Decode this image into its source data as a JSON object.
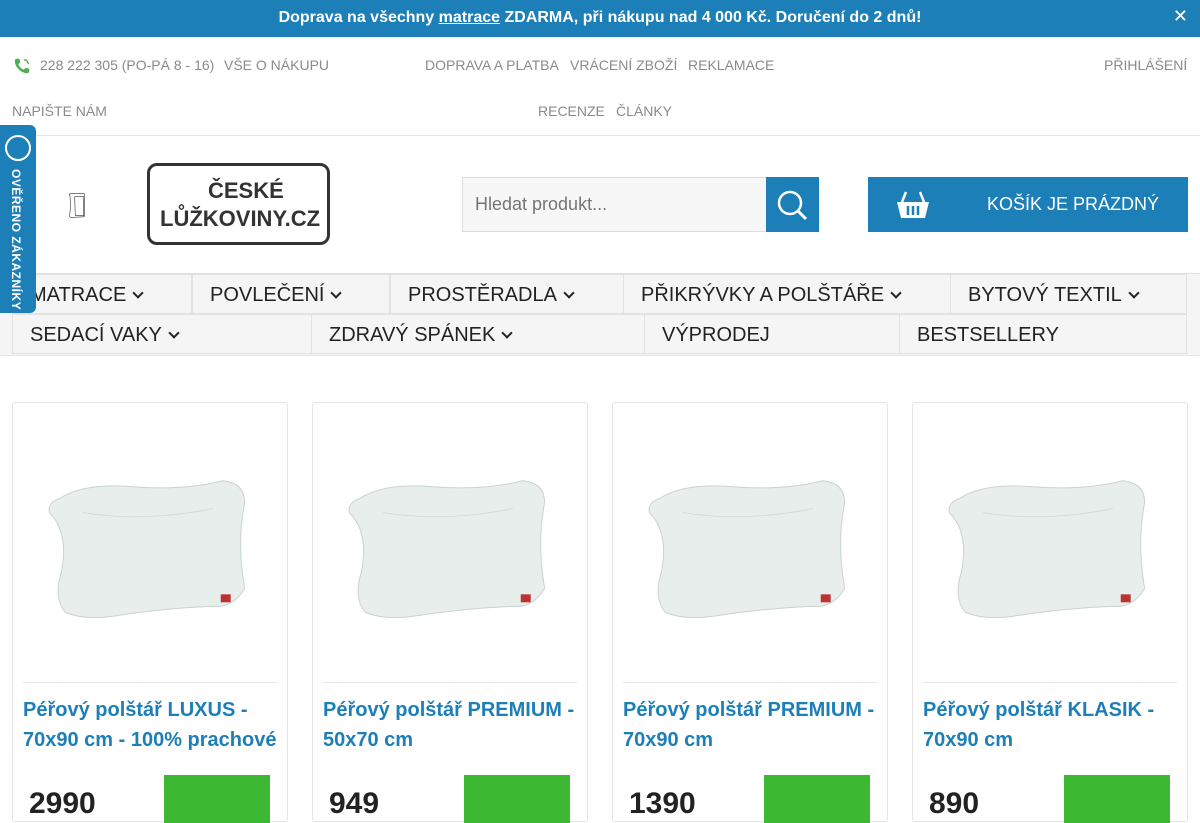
{
  "announcement": {
    "prefix": "Doprava na všechny",
    "link": "matrace",
    "suffix": "ZDARMA, při nákupu nad 4 000 Kč. Doručení do 2 dnů!",
    "close": "✕"
  },
  "utility": {
    "phone": "228 222 305 (PO-PÁ 8 - 16)",
    "links": [
      "VŠE O NÁKUPU",
      "DOPRAVA A PLATBA",
      "VRÁCENÍ ZBOŽÍ",
      "REKLAMACE",
      "PŘIHLÁŠENÍ",
      "NAPIŠTE NÁM",
      "RECENZE",
      "ČLÁNKY"
    ]
  },
  "logo": {
    "line1": "ČESKÉ",
    "line2": "LŮŽKOVINY.CZ"
  },
  "search": {
    "placeholder": "Hledat produkt..."
  },
  "cart": {
    "label": "KOŠÍK JE PRÁZDNÝ"
  },
  "badge": {
    "text": "OVĚŘENO ZÁKAZNÍKY"
  },
  "nav": [
    {
      "label": "MATRACE",
      "chevron": true
    },
    {
      "label": "POVLEČENÍ",
      "chevron": true
    },
    {
      "label": "PROSTĚRADLA",
      "chevron": true
    },
    {
      "label": "PŘIKRÝVKY A POLŠTÁŘE",
      "chevron": true
    },
    {
      "label": "BYTOVÝ TEXTIL",
      "chevron": true
    },
    {
      "label": "SEDACÍ VAKY",
      "chevron": true
    },
    {
      "label": "ZDRAVÝ SPÁNEK",
      "chevron": true
    },
    {
      "label": "VÝPRODEJ",
      "chevron": false
    },
    {
      "label": "BESTSELLERY",
      "chevron": false
    }
  ],
  "products": [
    {
      "title": "Péřový polštář LUXUS - 70x90 cm - 100% prachové",
      "price": "2990"
    },
    {
      "title": "Péřový polštář PREMIUM - 50x70 cm",
      "price": "949"
    },
    {
      "title": "Péřový polštář PREMIUM - 70x90 cm",
      "price": "1390"
    },
    {
      "title": "Péřový polštář KLASIK - 70x90 cm",
      "price": "890"
    }
  ],
  "colors": {
    "brand": "#1d7fb8",
    "buy": "#3cb832"
  }
}
